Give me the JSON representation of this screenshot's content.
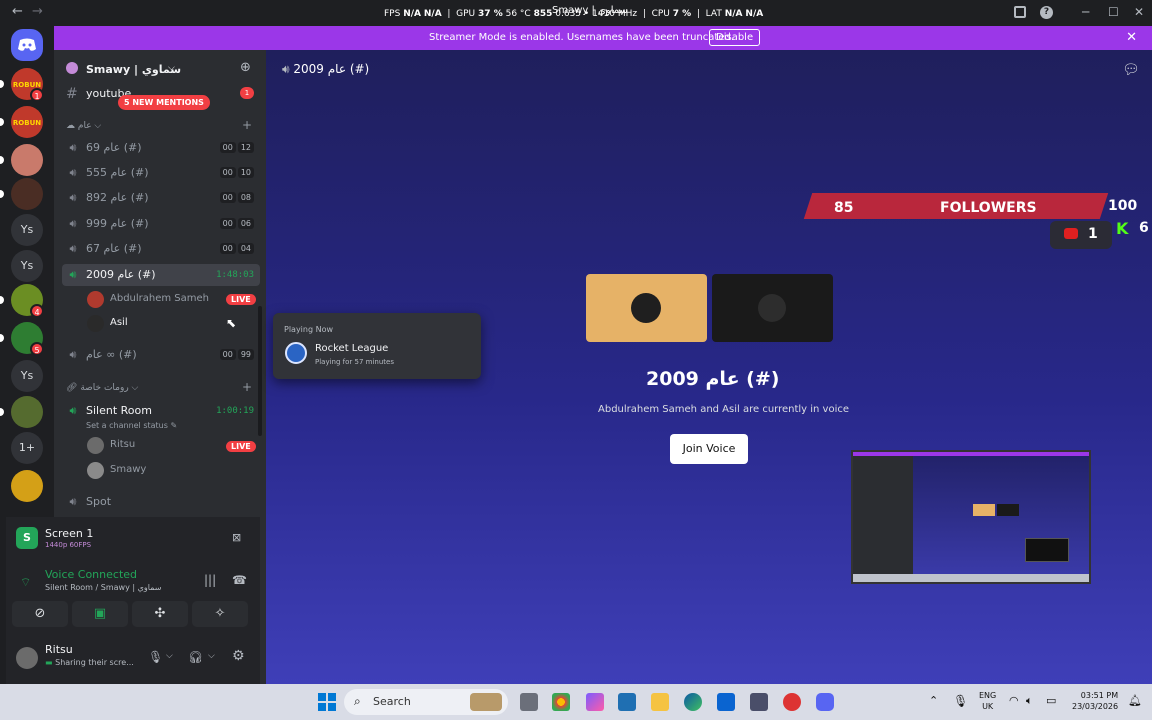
{
  "titlebar": {
    "back": "←",
    "forward": "→",
    "stats": {
      "fps_label": "FPS",
      "fps_val": "N/A",
      "fps_val2": "N/A",
      "gpu_label": "GPU",
      "gpu_pct": "37 %",
      "gpu_temp": "56 °C",
      "gpu_extra": "855",
      "gpu_mem": "0.635 •",
      "gpu_clock": "1410 MHz",
      "cpu_label": "CPU",
      "cpu_pct": "7 %",
      "lat_label": "LAT",
      "lat_val": "N/A",
      "lat_val2": "N/A"
    },
    "app_title": "Smawy | سماوي",
    "minimize": "─",
    "maximize": "☐",
    "close": "✕"
  },
  "banner": {
    "message": "Streamer Mode is enabled. Usernames have been truncated.",
    "button": "Disable",
    "close": "✕"
  },
  "servers": [
    {
      "label": "ROBUN",
      "badge": "1",
      "color": "#c0392b"
    },
    {
      "label": "ROBUN",
      "badge": "",
      "color": "#c0392b"
    },
    {
      "label": "",
      "badge": "",
      "color": "#c97a6b"
    },
    {
      "label": "",
      "badge": "",
      "color": "#4a2d24"
    },
    {
      "label": "Ys",
      "badge": "",
      "color": "#313338"
    },
    {
      "label": "Ys",
      "badge": "",
      "color": "#313338"
    },
    {
      "label": "",
      "badge": "4",
      "color": "#6b8e23"
    },
    {
      "label": "",
      "badge": "5",
      "color": "#2e7d32"
    },
    {
      "label": "Ys",
      "badge": "",
      "color": "#313338"
    },
    {
      "label": "",
      "badge": "",
      "color": "#556b2f"
    },
    {
      "label": "1+",
      "badge": "",
      "color": "#313338"
    },
    {
      "label": "",
      "badge": "",
      "color": "#d4a017"
    }
  ],
  "sidebar": {
    "server_name": "Smawy | سماوي",
    "youtube_channel": "youtube",
    "youtube_badge": "1",
    "new_mentions": "5 NEW MENTIONS",
    "category_1": "عام",
    "channels": [
      {
        "name": "عام 69 (#)",
        "c1": "00",
        "c2": "12"
      },
      {
        "name": "عام 555 (#)",
        "c1": "00",
        "c2": "10"
      },
      {
        "name": "عام 892 (#)",
        "c1": "00",
        "c2": "08"
      },
      {
        "name": "عام 999 (#)",
        "c1": "00",
        "c2": "06"
      },
      {
        "name": "عام 67 (#)",
        "c1": "00",
        "c2": "04"
      }
    ],
    "active_channel": {
      "name": "عام 2009 (#)",
      "timer": "1:48:03"
    },
    "active_users": [
      {
        "name": "Abdulrahem Sameh",
        "live": "LIVE"
      },
      {
        "name": "Asil",
        "live": ""
      }
    ],
    "infinity_channel": {
      "name": "عام ∞ (#)",
      "c1": "00",
      "c2": "99"
    },
    "category_2": "رومات خاصة",
    "silent_room": {
      "name": "Silent Room",
      "timer": "1:00:19",
      "status": "Set a channel status"
    },
    "silent_users": [
      {
        "name": "Ritsu",
        "live": "LIVE"
      },
      {
        "name": "Smawy",
        "live": ""
      }
    ],
    "spot_channel": "Spot"
  },
  "panel": {
    "screen_title": "Screen 1",
    "screen_sub": "1440p 60FPS",
    "voice_title": "Voice Connected",
    "voice_sub": "Silent Room / Smawy | سماوي",
    "user_name": "Ritsu",
    "user_status": "Sharing their scre..."
  },
  "main": {
    "header": "عام 2009 (#)",
    "title": "عام 2009 (#)",
    "subtitle": "Abdulrahem Sameh and Asil are currently in voice",
    "join": "Join Voice"
  },
  "overlay": {
    "followers_num": "85",
    "followers_label": "FOLLOWERS",
    "followers_goal": "100",
    "yt_count": "1",
    "kick_count": "6"
  },
  "popup": {
    "heading": "Playing Now",
    "game": "Rocket League",
    "time": "Playing for 57 minutes"
  },
  "taskbar": {
    "search": "Search",
    "lang1": "ENG",
    "lang2": "UK",
    "time": "03:51 PM",
    "date": "23/03/2026"
  }
}
